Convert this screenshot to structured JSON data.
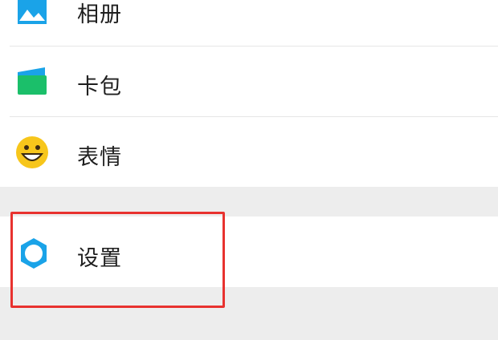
{
  "menu": {
    "items": [
      {
        "label": "相册",
        "icon": "album-icon"
      },
      {
        "label": "卡包",
        "icon": "card-wallet-icon"
      },
      {
        "label": "表情",
        "icon": "emoji-smile-icon"
      },
      {
        "label": "设置",
        "icon": "settings-gear-icon"
      }
    ]
  },
  "colors": {
    "accent_blue": "#1aa3e8",
    "emoji_yellow": "#f7c61b",
    "wallet_green": "#1bbf6a",
    "highlight_red": "#e8322f"
  }
}
